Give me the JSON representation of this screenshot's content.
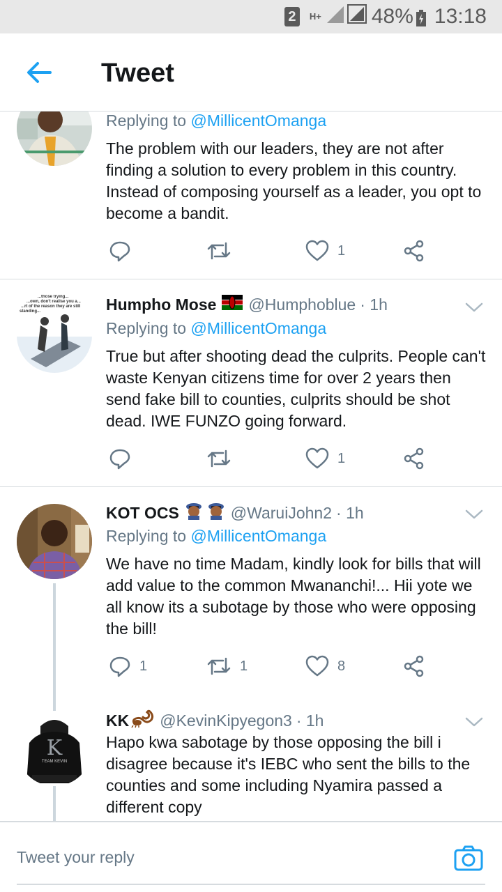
{
  "status_bar": {
    "sim": "2",
    "network": "H+",
    "battery_percent": "48%",
    "time": "13:18"
  },
  "header": {
    "title": "Tweet",
    "back_icon": "arrow-left-icon"
  },
  "tweets": [
    {
      "name": "",
      "handle": "",
      "time": "",
      "replying_prefix": "Replying to",
      "replying_to": "@MillicentOmanga",
      "text": "The problem with our leaders, they are not after finding a solution to every problem in this country. Instead of composing yourself as a leader, you opt to become a bandit.",
      "replies": "",
      "retweets": "",
      "likes": "1"
    },
    {
      "name": "Humpho Mose",
      "name_emoji": "kenya-flag-icon",
      "handle": "@Humphoblue",
      "time": "· 1h",
      "avatar_caption_lines": [
        "...those trying...",
        "...own, don't realise you a...",
        "...rt of the reason they are still",
        "standing..."
      ],
      "replying_prefix": "Replying to",
      "replying_to": "@MillicentOmanga",
      "text": "True but after shooting dead the culprits. People can't waste Kenyan citizens time for over 2 years then send fake bill to counties, culprits should be shot dead. IWE FUNZO going forward.",
      "replies": "",
      "retweets": "",
      "likes": "1"
    },
    {
      "name": "KOT OCS",
      "name_emoji": "police-officer-icon",
      "handle": "@WaruiJohn2",
      "time": "· 1h",
      "replying_prefix": "Replying to",
      "replying_to": "@MillicentOmanga",
      "text": "We have no time Madam, kindly look for bills that will add value to the common Mwananchi!... Hii yote we all know its a subotage by those who were opposing the bill!",
      "replies": "1",
      "retweets": "1",
      "likes": "8"
    },
    {
      "name": "KK",
      "name_emoji": "scorpion-icon",
      "handle": "@KevinKipyegon3",
      "time": "· 1h",
      "avatar_text": "K",
      "avatar_subtext": "TEAM KEVIN",
      "text": "Hapo kwa sabotage by those opposing the bill i disagree because it's IEBC who sent the bills to the counties and some including Nyamira passed a different copy"
    }
  ],
  "composer": {
    "placeholder": "Tweet your reply",
    "camera_icon": "camera-icon"
  },
  "colors": {
    "accent": "#1da1f2",
    "secondary_text": "#657786",
    "divider": "#d6dbdf"
  }
}
